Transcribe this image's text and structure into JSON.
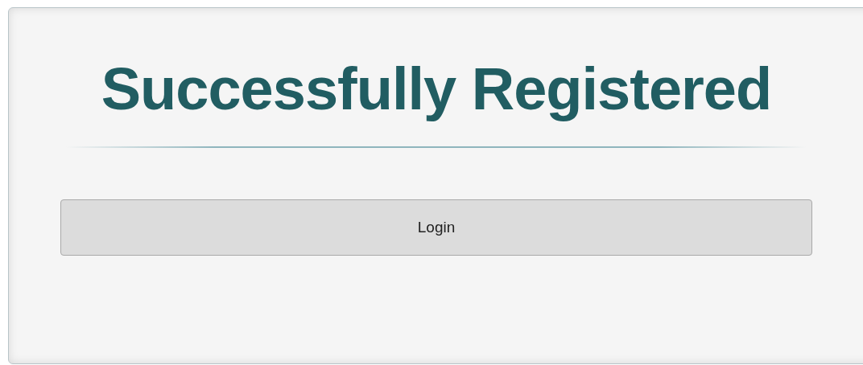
{
  "title": "Successfully Registered",
  "buttons": [
    {
      "label": "Login"
    }
  ]
}
